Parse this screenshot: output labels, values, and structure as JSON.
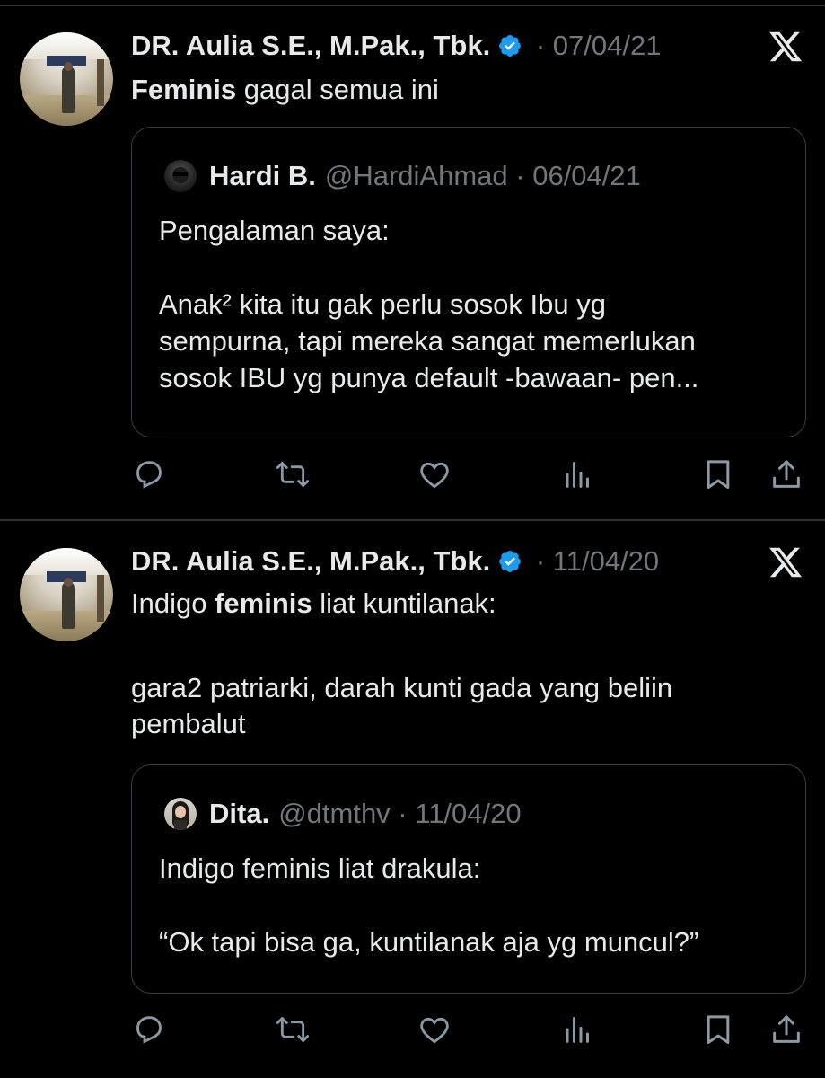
{
  "colors": {
    "background": "#000000",
    "primary_text": "#e7e9ea",
    "secondary_text": "#71767b",
    "border": "#2f3336",
    "verified_blue": "#1d9bf0"
  },
  "tweets": [
    {
      "author_name": "DR. Aulia S.E., M.Pak., Tbk.",
      "date": "07/04/21",
      "text_bold": "Feminis",
      "text_rest": " gagal semua ini",
      "quote": {
        "name": "Hardi B.",
        "handle": "@HardiAhmad",
        "date": "06/04/21",
        "text": "Pengalaman saya:\n\nAnak² kita itu gak perlu sosok Ibu yg\nsempurna, tapi mereka sangat memerlukan\nsosok IBU yg punya default -bawaan- pen..."
      }
    },
    {
      "author_name": "DR. Aulia S.E., M.Pak., Tbk.",
      "date": "11/04/20",
      "text_pre": "Indigo ",
      "text_bold": "feminis",
      "text_post": " liat kuntilanak:",
      "text_more": "gara2 patriarki, darah kunti gada yang beliin\npembalut",
      "quote": {
        "name": "Dita.",
        "handle": "@dtmthv",
        "date": "11/04/20",
        "text": "Indigo feminis liat drakula:\n\n“Ok tapi bisa ga, kuntilanak aja yg muncul?”"
      }
    }
  ],
  "separator": " · ",
  "icons": [
    "reply-icon",
    "retweet-icon",
    "like-icon",
    "views-icon",
    "bookmark-icon",
    "share-icon",
    "x-logo-icon",
    "verified-badge-icon"
  ]
}
